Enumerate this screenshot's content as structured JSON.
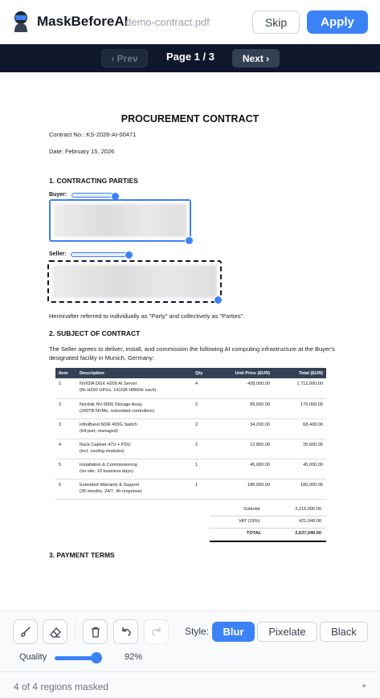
{
  "header": {
    "app_name": "MaskBeforeAI",
    "file_name": "demo-contract.pdf",
    "skip_label": "Skip",
    "apply_label": "Apply"
  },
  "nav": {
    "prev_label": "‹ Prev",
    "page_label": "Page 1 / 3",
    "next_label": "Next ›"
  },
  "document": {
    "title": "PROCUREMENT CONTRACT",
    "contract_no": "Contract No.: KS-2026-AI-00471",
    "date": "Date: February 15, 2026",
    "section1": "1. CONTRACTING PARTIES",
    "buyer_label": "Buyer:",
    "seller_label": "Seller:",
    "parties_note": "Hereinafter referred to individually as \"Party\" and collectively as \"Parties\".",
    "section2": "2. SUBJECT OF CONTRACT",
    "subject_text": "The Seller agrees to deliver, install, and commission the following AI computing infrastructure at the Buyer's designated facility in Munich, Germany:",
    "section3": "3. PAYMENT TERMS",
    "table": {
      "headers": [
        "Item",
        "Description",
        "Qty",
        "Unit Price (EUR)",
        "Total (EUR)"
      ],
      "rows": [
        {
          "item": "1",
          "desc1": "NVIDIA DGX H200 AI Server",
          "desc2": "(8x H200 GPUs, 141GB HBM3e each)",
          "qty": "4",
          "unit": "428,000.00",
          "total": "1,712,000.00"
        },
        {
          "item": "2",
          "desc1": "Nordvik NV-9000 Storage Array",
          "desc2": "(200TB NVMe, redundant controllers)",
          "qty": "2",
          "unit": "89,500.00",
          "total": "179,000.00"
        },
        {
          "item": "3",
          "desc1": "InfiniBand NDR 400G Switch",
          "desc2": "(64-port, managed)",
          "qty": "2",
          "unit": "34,200.00",
          "total": "68,400.00"
        },
        {
          "item": "4",
          "desc1": "Rack Cabinet 47U + PDU",
          "desc2": "(incl. cooling modules)",
          "qty": "2",
          "unit": "12,800.00",
          "total": "25,600.00"
        },
        {
          "item": "5",
          "desc1": "Installation & Commissioning",
          "desc2": "(on-site, 10 business days)",
          "qty": "1",
          "unit": "45,000.00",
          "total": "45,000.00"
        },
        {
          "item": "6",
          "desc1": "Extended Warranty & Support",
          "desc2": "(36 months, 24/7, 4h response)",
          "qty": "1",
          "unit": "186,000.00",
          "total": "186,000.00"
        }
      ],
      "subtotal_label": "Subtotal",
      "subtotal_value": "2,216,000.00",
      "vat_label": "VAT (19%)",
      "vat_value": "421,040.00",
      "total_label": "TOTAL",
      "total_value": "2,637,040.00"
    }
  },
  "toolbar": {
    "style_label": "Style:",
    "styles": [
      "Blur",
      "Pixelate",
      "Black"
    ],
    "active_style": "Blur",
    "quality_label": "Quality",
    "quality_value": "92%",
    "quality_fraction": 0.92,
    "tools": [
      "brush-icon",
      "eraser-icon",
      "trash-icon",
      "undo-icon",
      "redo-icon"
    ]
  },
  "status": {
    "text": "4 of 4 regions masked"
  },
  "colors": {
    "accent": "#3b82f6",
    "navbar": "#0f172a"
  }
}
